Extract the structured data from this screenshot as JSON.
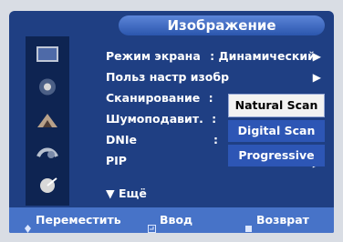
{
  "title": "Изображение",
  "menu": [
    {
      "label": "Режим экрана",
      "value": ": Динамический",
      "arrow": "▶"
    },
    {
      "label": "Польз настр изобр",
      "value": "",
      "arrow": "▶"
    },
    {
      "label": "Сканирование",
      "value": ":",
      "arrow": ""
    },
    {
      "label": "Шумоподавит.",
      "value": ":",
      "arrow": ""
    },
    {
      "label": "DNIe",
      "value": ":",
      "arrow": ""
    },
    {
      "label": "PIP",
      "value": "",
      "arrow": "▶"
    }
  ],
  "more": "▼ Ещё",
  "dropdown": [
    "Natural Scan",
    "Digital Scan",
    "Progressive"
  ],
  "selected_option": "Natural Scan",
  "bottom": {
    "move": "Переместить",
    "enter": "Ввод",
    "back": "Возврат"
  }
}
